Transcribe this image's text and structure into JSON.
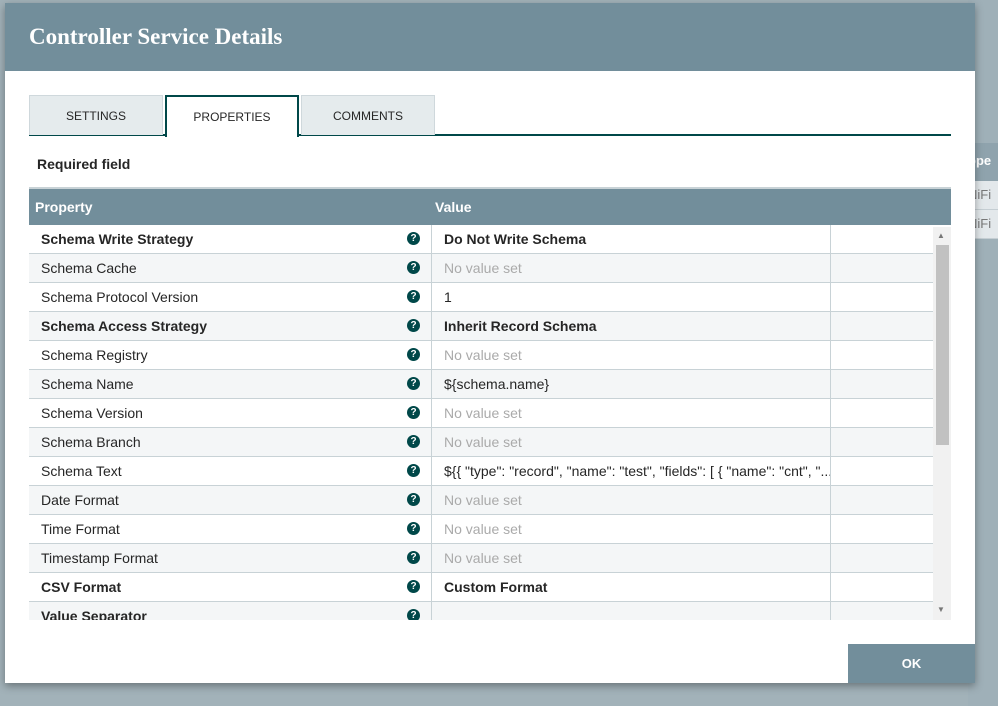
{
  "background": {
    "header": "ope",
    "cells": [
      "NiFi",
      "NiFi"
    ]
  },
  "dialog": {
    "title": "Controller Service Details"
  },
  "tabs": [
    {
      "label": "SETTINGS"
    },
    {
      "label": "PROPERTIES"
    },
    {
      "label": "COMMENTS"
    }
  ],
  "required_label": "Required field",
  "table": {
    "headers": {
      "property": "Property",
      "value": "Value"
    },
    "rows": [
      {
        "name": "Schema Write Strategy",
        "value": "Do Not Write Schema",
        "required": true
      },
      {
        "name": "Schema Cache",
        "value": "No value set",
        "empty": true
      },
      {
        "name": "Schema Protocol Version",
        "value": "1"
      },
      {
        "name": "Schema Access Strategy",
        "value": "Inherit Record Schema",
        "required": true
      },
      {
        "name": "Schema Registry",
        "value": "No value set",
        "empty": true
      },
      {
        "name": "Schema Name",
        "value": "${schema.name}"
      },
      {
        "name": "Schema Version",
        "value": "No value set",
        "empty": true
      },
      {
        "name": "Schema Branch",
        "value": "No value set",
        "empty": true
      },
      {
        "name": "Schema Text",
        "value": "${{ \"type\": \"record\", \"name\": \"test\", \"fields\": [ { \"name\": \"cnt\", \"..."
      },
      {
        "name": "Date Format",
        "value": "No value set",
        "empty": true
      },
      {
        "name": "Time Format",
        "value": "No value set",
        "empty": true
      },
      {
        "name": "Timestamp Format",
        "value": "No value set",
        "empty": true
      },
      {
        "name": "CSV Format",
        "value": "Custom Format",
        "required": true
      },
      {
        "name": "Value Separator",
        "value": "",
        "required": true
      }
    ]
  },
  "ok_label": "OK"
}
